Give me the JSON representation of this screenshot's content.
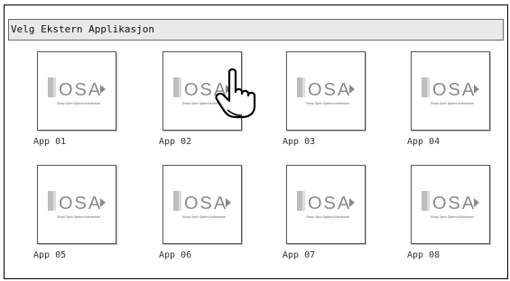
{
  "dialog": {
    "title": "Velg Ekstern Applikasjon"
  },
  "apps": [
    {
      "label": "App 01",
      "logo_text": "OSA",
      "logo_subtext": "Sharp Open System Architecture"
    },
    {
      "label": "App 02",
      "logo_text": "OSA",
      "logo_subtext": "Sharp Open System Architecture"
    },
    {
      "label": "App 03",
      "logo_text": "OSA",
      "logo_subtext": "Sharp Open System Architecture"
    },
    {
      "label": "App 04",
      "logo_text": "OSA",
      "logo_subtext": "Sharp Open System Architecture"
    },
    {
      "label": "App 05",
      "logo_text": "OSA",
      "logo_subtext": "Sharp Open System Architecture"
    },
    {
      "label": "App 06",
      "logo_text": "OSA",
      "logo_subtext": "Sharp Open System Architecture"
    },
    {
      "label": "App 07",
      "logo_text": "OSA",
      "logo_subtext": "Sharp Open System Architecture"
    },
    {
      "label": "App 08",
      "logo_text": "OSA",
      "logo_subtext": "Sharp Open System Architecture"
    }
  ],
  "icons": {
    "pointer": "hand-pointer-icon"
  },
  "colors": {
    "logo_gray": "#8a8a8a",
    "title_bar_bg": "#e9e9e9"
  }
}
